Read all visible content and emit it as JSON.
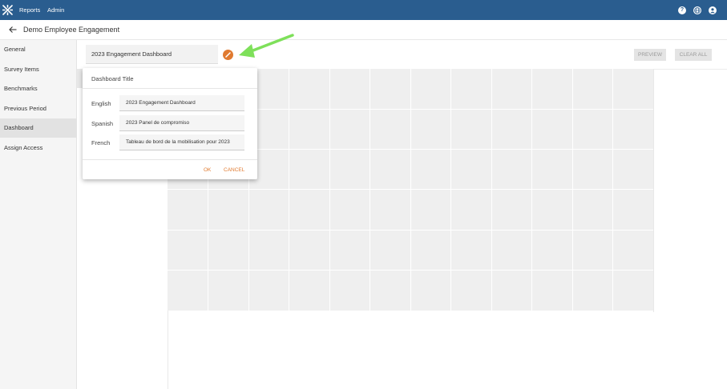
{
  "nav": {
    "items": [
      {
        "label": "Reports"
      },
      {
        "label": "Admin"
      }
    ],
    "help_icon_glyph": "?",
    "brand_color": "#2a5d8f"
  },
  "page": {
    "title": "Demo Employee Engagement"
  },
  "sidebar": {
    "items": [
      {
        "label": "General"
      },
      {
        "label": "Survey Items"
      },
      {
        "label": "Benchmarks"
      },
      {
        "label": "Previous Period"
      },
      {
        "label": "Dashboard",
        "active": true
      },
      {
        "label": "Assign Access"
      }
    ]
  },
  "toolbar": {
    "dashboard_title": "2023 Engagement Dashboard",
    "preview_label": "PREVIEW",
    "clear_label": "CLEAR ALL",
    "accent_color": "#e07a30",
    "annotation_arrow_color": "#7ee05a"
  },
  "dialog": {
    "title": "Dashboard Title",
    "rows": [
      {
        "language": "English",
        "value": "2023 Engagement Dashboard"
      },
      {
        "language": "Spanish",
        "value": "2023 Panel de compromiso"
      },
      {
        "language": "French",
        "value": "Tableau de bord de la mobilisation pour 2023"
      }
    ],
    "ok_label": "OK",
    "cancel_label": "CANCEL"
  }
}
